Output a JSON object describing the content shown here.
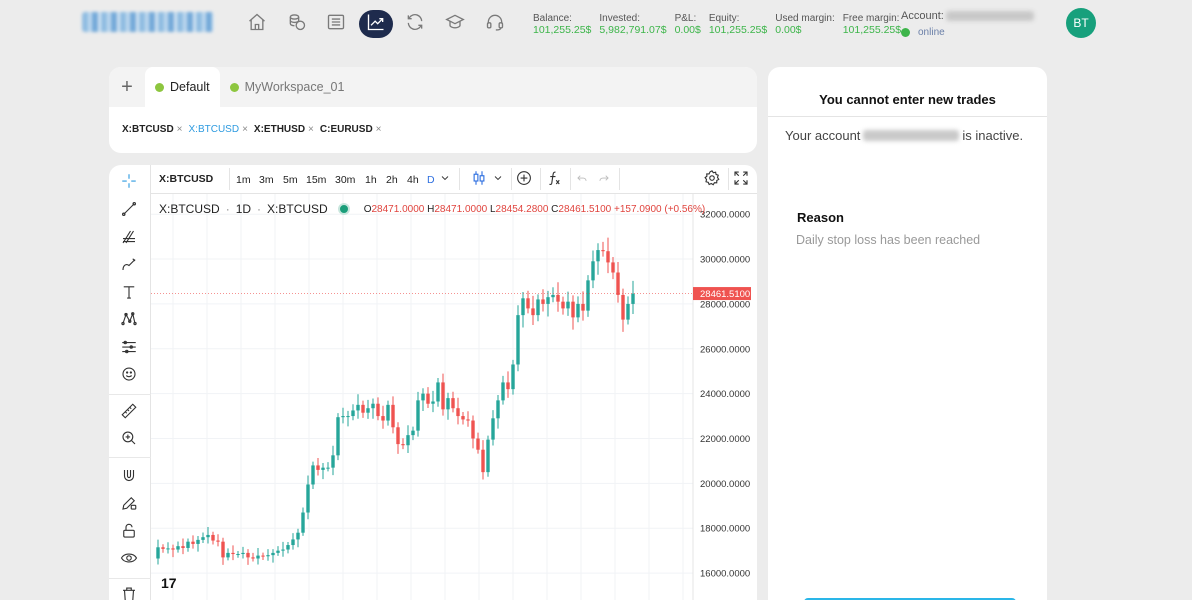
{
  "nav": {
    "items": [
      {
        "name": "home-icon"
      },
      {
        "name": "coins-icon"
      },
      {
        "name": "list-icon"
      },
      {
        "name": "chart-trend-icon",
        "active": true
      },
      {
        "name": "refresh-icon"
      },
      {
        "name": "graduation-cap-icon"
      },
      {
        "name": "headset-icon"
      }
    ],
    "active_color": "#1e2b4d"
  },
  "stats": [
    {
      "label": "Balance:",
      "value": "101,255.25$"
    },
    {
      "label": "Invested:",
      "value": "5,982,791.07$"
    },
    {
      "label": "P&L:",
      "value": "0.00$"
    },
    {
      "label": "Equity:",
      "value": "101,255.25$"
    },
    {
      "label": "Used margin:",
      "value": "0.00$"
    },
    {
      "label": "Free margin:",
      "value": "101,255.25$"
    }
  ],
  "account": {
    "label": "Account:",
    "status": "online",
    "avatar_initials": "BT"
  },
  "workspace": {
    "tabs": [
      {
        "label": "Default",
        "active": true
      },
      {
        "label": "MyWorkspace_01",
        "active": false
      }
    ],
    "symbols": [
      {
        "label": "X:BTCUSD",
        "active": false
      },
      {
        "label": "X:BTCUSD",
        "active": true
      },
      {
        "label": "X:ETHUSD",
        "active": false
      },
      {
        "label": "C:EURUSD",
        "active": false
      }
    ],
    "close_glyph": "×",
    "plus_glyph": "+"
  },
  "chart_toolbar": {
    "symbol": "X:BTCUSD",
    "timeframes": [
      "1m",
      "3m",
      "5m",
      "15m",
      "30m",
      "1h",
      "2h",
      "4h",
      "D"
    ],
    "active_timeframe": "D"
  },
  "legend": {
    "symbol": "X:BTCUSD",
    "interval": "1D",
    "exchange": "X:BTCUSD",
    "open_label": "O",
    "open": "28471.0000",
    "high_label": "H",
    "high": "28471.0000",
    "low_label": "L",
    "low": "28454.2800",
    "close_label": "C",
    "close": "28461.5100",
    "change": "+157.0900 (+0.56%)"
  },
  "chart_data": {
    "type": "candlestick",
    "ylim": [
      14800,
      32900
    ],
    "y_ticks": [
      16000,
      18000,
      20000,
      22000,
      24000,
      26000,
      28000,
      30000,
      32000
    ],
    "y_tick_labels": [
      "16000.0000",
      "18000.0000",
      "20000.0000",
      "22000.0000",
      "24000.0000",
      "26000.0000",
      "28000.0000",
      "30000.0000",
      "32000.0000"
    ],
    "last_price": 28461.51,
    "last_price_label": "28461.5100",
    "up_color": "#26a69a",
    "down_color": "#ef5350",
    "closes": [
      16650,
      17150,
      17080,
      17100,
      17050,
      17200,
      17120,
      17400,
      17300,
      17480,
      17600,
      17700,
      17450,
      17400,
      16700,
      16900,
      16850,
      16850,
      16900,
      16700,
      16650,
      16780,
      16750,
      16800,
      16900,
      17000,
      17050,
      17250,
      17500,
      17800,
      18700,
      19950,
      20800,
      20600,
      20700,
      20700,
      21250,
      22950,
      23000,
      23000,
      23250,
      23500,
      23150,
      23350,
      23550,
      23000,
      22800,
      23500,
      22500,
      21750,
      21700,
      22150,
      22350,
      23700,
      24000,
      23550,
      23650,
      24500,
      23300,
      23800,
      23350,
      23000,
      22850,
      22800,
      22000,
      21500,
      20500,
      21950,
      22900,
      23700,
      24500,
      24200,
      25300,
      27500,
      28250,
      27800,
      27500,
      28200,
      28000,
      28300,
      28400,
      28100,
      27800,
      28100,
      27400,
      28000,
      27700,
      29050,
      29900,
      30400,
      30350,
      29850,
      29400,
      28400,
      27300,
      28000,
      28460
    ]
  },
  "right_panel": {
    "title": "You cannot enter new trades",
    "account_prefix": "Your account",
    "account_suffix": "is inactive.",
    "reason_heading": "Reason",
    "reason_text": "Daily stop loss has been reached"
  },
  "tv_logo": "17"
}
